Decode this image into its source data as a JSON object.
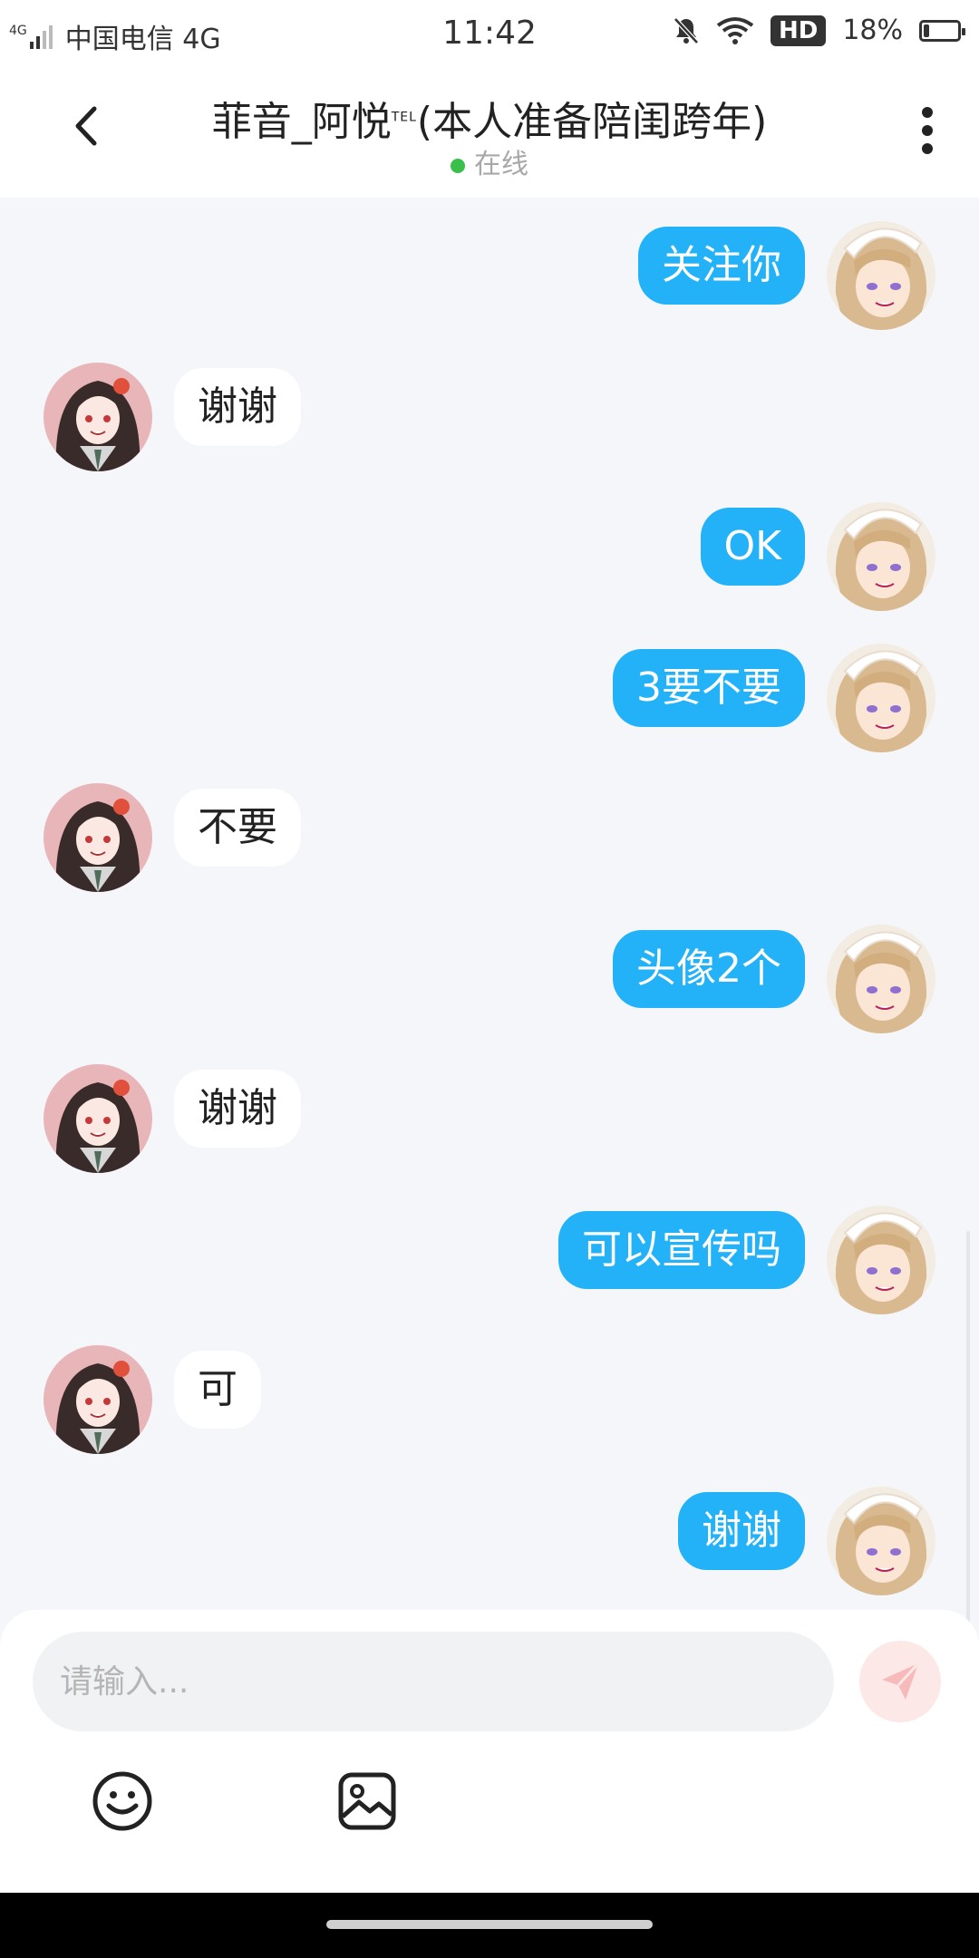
{
  "status_bar": {
    "carrier": "中国电信 4G",
    "network_small": "4G",
    "time": "11:42",
    "hd_label": "HD",
    "battery_text": "18%",
    "battery_level": 0.18
  },
  "header": {
    "title_main": "菲音_阿悦",
    "title_tag": "TEL",
    "title_suffix": "(本人准备陪闺跨年)",
    "online_status": "在线",
    "online_color": "#39c04b"
  },
  "messages": [
    {
      "from": "me",
      "text": "关注你"
    },
    {
      "from": "them",
      "text": "谢谢"
    },
    {
      "from": "me",
      "text": "OK"
    },
    {
      "from": "me",
      "text": "3要不要"
    },
    {
      "from": "them",
      "text": "不要"
    },
    {
      "from": "me",
      "text": "头像2个"
    },
    {
      "from": "them",
      "text": "谢谢"
    },
    {
      "from": "me",
      "text": "可以宣传吗"
    },
    {
      "from": "them",
      "text": "可"
    },
    {
      "from": "me",
      "text": "谢谢"
    }
  ],
  "input": {
    "placeholder": "请输入...",
    "value": ""
  },
  "icons": {
    "back": "chevron-left-icon",
    "more": "more-vertical-icon",
    "send": "send-icon",
    "emoji": "emoji-icon",
    "image": "image-icon"
  },
  "colors": {
    "my_bubble": "#23b2f8",
    "their_bubble": "#ffffff",
    "background": "#f4f6f9",
    "send_button": "#fde8e8"
  }
}
